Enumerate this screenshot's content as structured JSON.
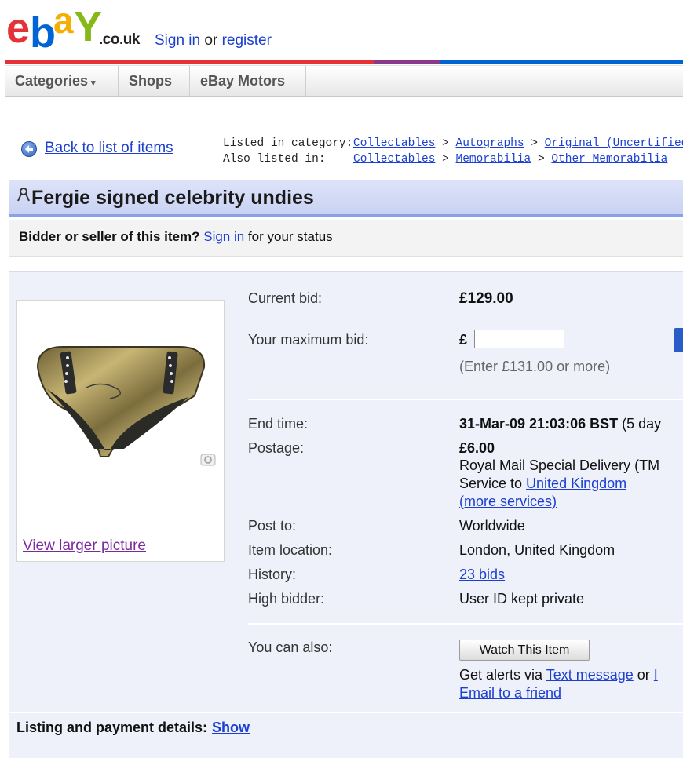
{
  "header": {
    "logo_text": "ebay",
    "tld": ".co.uk",
    "sign_in_label": "Sign in",
    "or_text": " or ",
    "register_label": "register"
  },
  "colors": {
    "ebay_red": "#e53238",
    "ebay_blue": "#0064d2",
    "ebay_yellow": "#f5af02",
    "ebay_green": "#86b817",
    "link_blue": "#1b3fd1"
  },
  "nav": {
    "tabs": [
      {
        "label": "Categories",
        "caret": "▾"
      },
      {
        "label": "Shops"
      },
      {
        "label": "eBay Motors"
      }
    ]
  },
  "back_link": "Back to list of items",
  "categories": {
    "listed_label": "Listed in category:",
    "listed_path": [
      "Collectables",
      "Autographs",
      "Original (Uncertified"
    ],
    "also_label": "Also listed in:",
    "also_path": [
      "Collectables",
      "Memorabilia",
      "Other Memorabilia"
    ],
    "separator": ">"
  },
  "item": {
    "title": "Fergie signed celebrity undies",
    "view_larger": "View larger picture"
  },
  "status": {
    "question": "Bidder or seller of this item?",
    "sign_in": "Sign in",
    "suffix": "for your status"
  },
  "details": {
    "current_bid_label": "Current bid:",
    "current_bid_value": "£129.00",
    "max_bid_label": "Your maximum bid:",
    "currency_symbol": "£",
    "max_bid_value": "",
    "hint": "(Enter £131.00 or more)",
    "end_time_label": "End time:",
    "end_time_value": "31-Mar-09 21:03:06 BST",
    "end_time_suffix": "(5 day",
    "postage_label": "Postage:",
    "postage_price": "£6.00",
    "postage_service": "Royal Mail Special Delivery (TM",
    "service_to_prefix": "Service to ",
    "service_to_link": "United Kingdom",
    "more_services": "(more services)",
    "post_to_label": "Post to:",
    "post_to_value": "Worldwide",
    "location_label": "Item location:",
    "location_value": "London, United Kingdom",
    "history_label": "History:",
    "history_value": "23 bids",
    "high_bidder_label": "High bidder:",
    "high_bidder_value": "User ID kept private",
    "also_label": "You can also:",
    "watch_button": "Watch This Item",
    "alerts_prefix": "Get alerts via ",
    "alerts_link": "Text message",
    "alerts_or": " or ",
    "alerts_link2": "I",
    "email_friend": "Email to a friend"
  },
  "footer": {
    "listing_label": "Listing and payment details:",
    "show_label": "Show"
  }
}
